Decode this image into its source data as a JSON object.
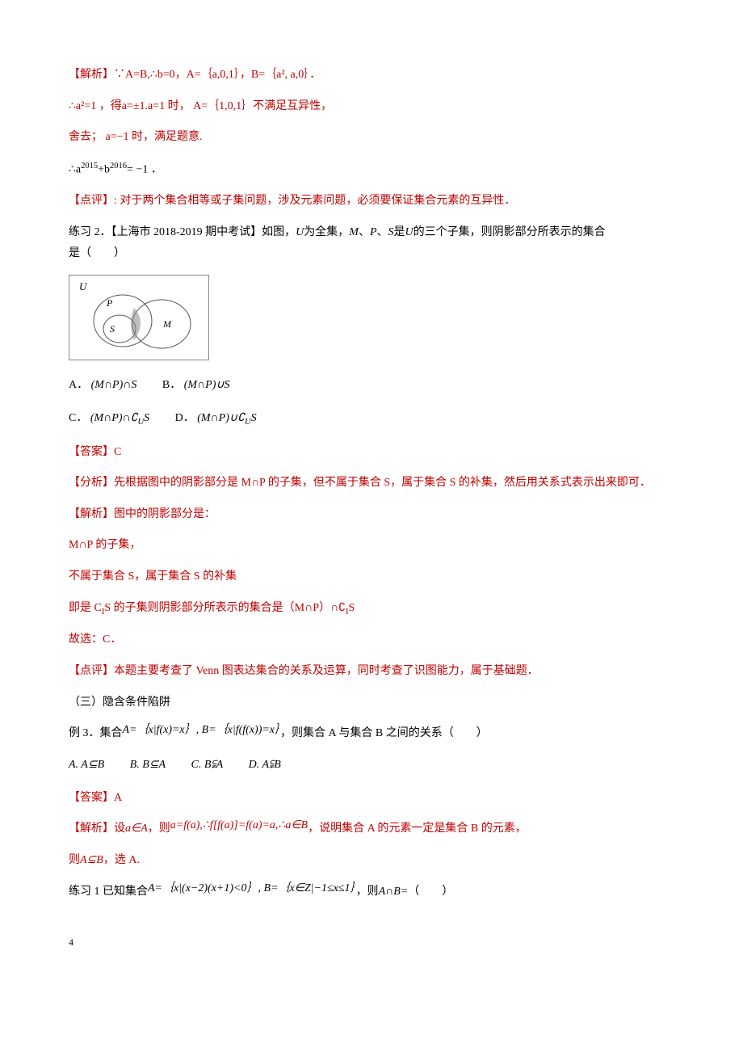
{
  "p1": "【解析】∵A=B,∴b=0，A=｛a,0,1｝，B=｛a²,  a,0｝．",
  "p2": "∴a²=1 ，得a=±1.a=1 时， A=｛1,0,1｝不满足互异性，",
  "p3": "舍去； a=−1 时，满足题意.",
  "p4_prefix": "∴a",
  "p4_sup1": "2015",
  "p4_mid": "+b",
  "p4_sup2": "2016",
  "p4_suffix": "= −1 ．",
  "p5": "【点评】: 对于两个集合相等或子集问题，涉及元素问题，必须要保证集合元素的互异性．",
  "p6_a": "练习 2．【上海市 2018-2019 期中考试】如图，",
  "p6_b": "为全集，",
  "p6_c": "、",
  "p6_d": "、",
  "p6_e": "是",
  "p6_f": "的三个子集，则阴影部分所表示的集合",
  "p6_g": "是（　　）",
  "venn": {
    "U": "U",
    "P": "P",
    "S": "S",
    "M": "M"
  },
  "m_U": "U",
  "m_M": "M",
  "m_P": "P",
  "m_S": "S",
  "opts1": {
    "A": "A．",
    "A_expr": "(M∩P)∩S",
    "B": "B．",
    "B_expr": "(M∩P)∪S"
  },
  "opts2": {
    "C": "C．",
    "C_expr_a": "(M∩P)∩∁",
    "C_expr_b": "U",
    "C_expr_c": "S",
    "D": "D．",
    "D_expr_a": "(M∩P)∪∁",
    "D_expr_b": "U",
    "D_expr_c": "S"
  },
  "p7": "【答案】C",
  "p8": "【分析】先根据图中的阴影部分是 M∩P 的子集，但不属于集合 S，属于集合 S 的补集，然后用关系式表示出来即可．",
  "p9": "【解析】图中的阴影部分是：",
  "p10": "M∩P 的子集，",
  "p11": "不属于集合 S，属于集合 S 的补集",
  "p12_a": "即是 C",
  "p12_b": "I",
  "p12_c": "S 的子集则阴影部分所表示的集合是（M∩P）∩∁",
  "p12_d": "I",
  "p12_e": "S",
  "p13": "故选：C．",
  "p14": "【点评】本题主要考查了 Venn 图表达集合的关系及运算，同时考查了识图能力，属于基础题．",
  "p15": "（三）隐含条件陷阱",
  "p16_a": "例 3．集合",
  "p16_expr": "A=｛x|f(x)=x｝, B=｛x|f(f(x))=x｝",
  "p16_b": "，则集合 A 与集合 B 之间的关系（　　）",
  "opts3": {
    "A": "A.  A⊆B",
    "B": "B.  B⊆A",
    "C": "C.  B⫋A",
    "D": "D.  A⫋B"
  },
  "p17": "【答案】A",
  "p18_a": "【解析】设",
  "p18_b": "a∈A",
  "p18_c": "，则",
  "p18_d": "a=f(a),∴f[f(a)]=f(a)=a,∴a∈B",
  "p18_e": "，说明集合 A 的元素一定是集合 B 的元素，",
  "p19_a": "则",
  "p19_b": "A⊆B",
  "p19_c": "，选 A.",
  "p20_a": "练习 1 已知集合",
  "p20_expr": "A=｛x|(x−2)(x+1)<0｝, B=｛x∈Z|−1≤x≤1｝",
  "p20_b": "，则",
  "p20_c": "A∩B=",
  "p20_d": "（　　）",
  "page_num": "4"
}
